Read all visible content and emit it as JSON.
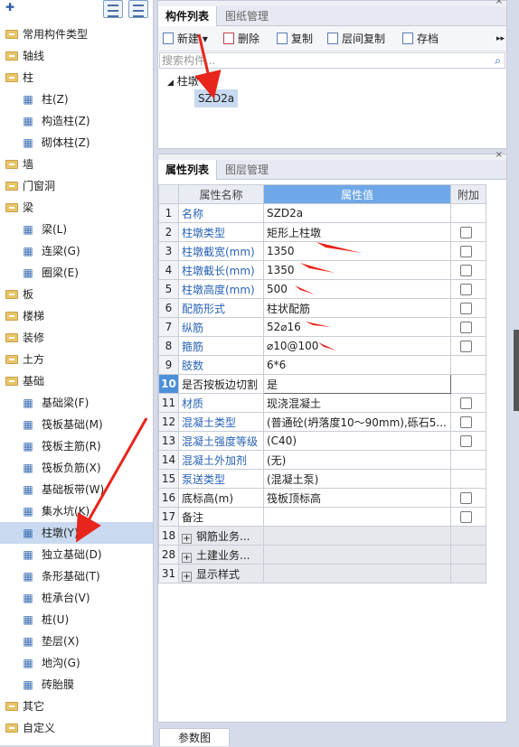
{
  "left_tree": {
    "items": [
      {
        "label": "常用构件类型",
        "type": "folder"
      },
      {
        "label": "轴线",
        "type": "folder"
      },
      {
        "label": "柱",
        "type": "folder"
      },
      {
        "label": "柱(Z)",
        "type": "leaf",
        "icon": "column-icon"
      },
      {
        "label": "构造柱(Z)",
        "type": "leaf",
        "icon": "construct-column-icon"
      },
      {
        "label": "砌体柱(Z)",
        "type": "leaf",
        "icon": "masonry-column-icon"
      },
      {
        "label": "墙",
        "type": "folder"
      },
      {
        "label": "门窗洞",
        "type": "folder"
      },
      {
        "label": "梁",
        "type": "folder"
      },
      {
        "label": "梁(L)",
        "type": "leaf",
        "icon": "beam-icon"
      },
      {
        "label": "连梁(G)",
        "type": "leaf",
        "icon": "link-beam-icon"
      },
      {
        "label": "圈梁(E)",
        "type": "leaf",
        "icon": "ring-beam-icon"
      },
      {
        "label": "板",
        "type": "folder"
      },
      {
        "label": "楼梯",
        "type": "folder"
      },
      {
        "label": "装修",
        "type": "folder"
      },
      {
        "label": "土方",
        "type": "folder"
      },
      {
        "label": "基础",
        "type": "folder"
      },
      {
        "label": "基础梁(F)",
        "type": "leaf",
        "icon": "foundation-beam-icon"
      },
      {
        "label": "筏板基础(M)",
        "type": "leaf",
        "icon": "raft-icon"
      },
      {
        "label": "筏板主筋(R)",
        "type": "leaf",
        "icon": "raft-main-rebar-icon"
      },
      {
        "label": "筏板负筋(X)",
        "type": "leaf",
        "icon": "raft-neg-rebar-icon"
      },
      {
        "label": "基础板带(W)",
        "type": "leaf",
        "icon": "strip-icon"
      },
      {
        "label": "集水坑(K)",
        "type": "leaf",
        "icon": "sump-icon"
      },
      {
        "label": "柱墩(Y)",
        "type": "leaf",
        "icon": "pier-icon",
        "selected": true
      },
      {
        "label": "独立基础(D)",
        "type": "leaf",
        "icon": "isolated-footing-icon"
      },
      {
        "label": "条形基础(T)",
        "type": "leaf",
        "icon": "strip-footing-icon"
      },
      {
        "label": "桩承台(V)",
        "type": "leaf",
        "icon": "pile-cap-icon"
      },
      {
        "label": "桩(U)",
        "type": "leaf",
        "icon": "pile-icon"
      },
      {
        "label": "垫层(X)",
        "type": "leaf",
        "icon": "cushion-icon"
      },
      {
        "label": "地沟(G)",
        "type": "leaf",
        "icon": "trench-icon"
      },
      {
        "label": "砖胎膜",
        "type": "leaf",
        "icon": "brick-mold-icon"
      },
      {
        "label": "其它",
        "type": "folder"
      },
      {
        "label": "自定义",
        "type": "folder"
      }
    ]
  },
  "top_panel": {
    "tabs": [
      "构件列表",
      "图纸管理"
    ],
    "toolbar": [
      "新建",
      "删除",
      "复制",
      "层间复制",
      "存档"
    ],
    "search_placeholder": "搜索构件...",
    "tree_root": "柱墩",
    "tree_child": "SZD2a"
  },
  "bottom_panel": {
    "tabs": [
      "属性列表",
      "图层管理"
    ],
    "headers": [
      "属性名称",
      "属性值",
      "附加"
    ],
    "rows": [
      {
        "n": "1",
        "name": "名称",
        "value": "SZD2a",
        "blue": true,
        "cb": false
      },
      {
        "n": "2",
        "name": "柱墩类型",
        "value": "矩形上柱墩",
        "blue": true,
        "cb": true
      },
      {
        "n": "3",
        "name": "柱墩截宽(mm)",
        "value": "1350",
        "blue": true,
        "cb": true
      },
      {
        "n": "4",
        "name": "柱墩截长(mm)",
        "value": "1350",
        "blue": true,
        "cb": true
      },
      {
        "n": "5",
        "name": "柱墩高度(mm)",
        "value": "500",
        "blue": true,
        "cb": true
      },
      {
        "n": "6",
        "name": "配筋形式",
        "value": "柱状配筋",
        "blue": true,
        "cb": true
      },
      {
        "n": "7",
        "name": "纵筋",
        "value": "52⌀16",
        "blue": true,
        "cb": true
      },
      {
        "n": "8",
        "name": "箍筋",
        "value": "⌀10@100",
        "blue": true,
        "cb": true
      },
      {
        "n": "9",
        "name": "肢数",
        "value": "6*6",
        "blue": true,
        "cb": false
      },
      {
        "n": "10",
        "name": "是否按板边切割",
        "value": "是",
        "blue": false,
        "cb": false,
        "current": true
      },
      {
        "n": "11",
        "name": "材质",
        "value": "现浇混凝土",
        "blue": true,
        "cb": true
      },
      {
        "n": "12",
        "name": "混凝土类型",
        "value": "(普通砼(坍落度10～90mm),砾石5...",
        "blue": true,
        "cb": true
      },
      {
        "n": "13",
        "name": "混凝土强度等级",
        "value": "(C40)",
        "blue": true,
        "cb": true
      },
      {
        "n": "14",
        "name": "混凝土外加剂",
        "value": "(无)",
        "blue": true,
        "cb": false
      },
      {
        "n": "15",
        "name": "泵送类型",
        "value": "(混凝土泵)",
        "blue": true,
        "cb": false
      },
      {
        "n": "16",
        "name": "底标高(m)",
        "value": "筏板顶标高",
        "blue": false,
        "cb": true
      },
      {
        "n": "17",
        "name": "备注",
        "value": "",
        "blue": false,
        "cb": true
      },
      {
        "n": "18",
        "name": "钢筋业务...",
        "value": "",
        "group": true
      },
      {
        "n": "28",
        "name": "土建业务...",
        "value": "",
        "group": true
      },
      {
        "n": "31",
        "name": "显示样式",
        "value": "",
        "group": true
      }
    ]
  },
  "bottom_tab": "参数图",
  "colors": {
    "accent": "#4a90d9",
    "arrow": "#e8251c",
    "link": "#2a63b8"
  }
}
